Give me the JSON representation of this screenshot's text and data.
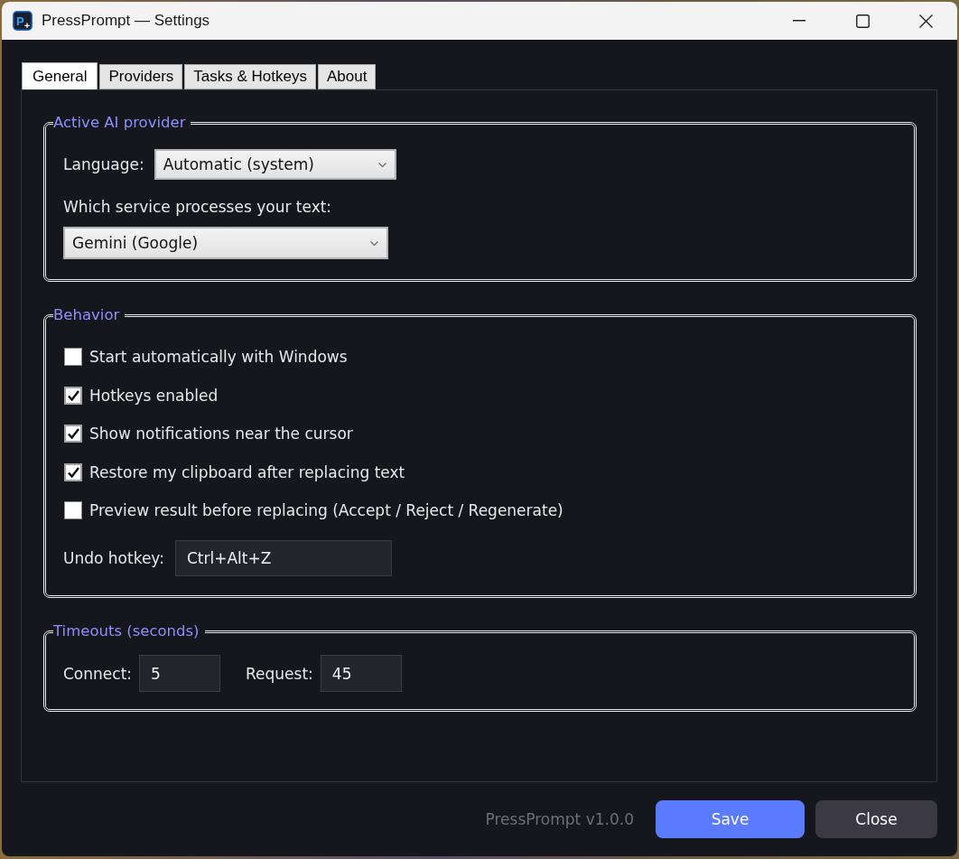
{
  "window": {
    "title": "PressPrompt — Settings",
    "logo_text": "P"
  },
  "tabs": [
    {
      "label": "General",
      "selected": true
    },
    {
      "label": "Providers",
      "selected": false
    },
    {
      "label": "Tasks & Hotkeys",
      "selected": false
    },
    {
      "label": "About",
      "selected": false
    }
  ],
  "provider_group": {
    "title": "Active AI provider",
    "language": {
      "label": "Language:",
      "value": "Automatic (system)"
    },
    "service": {
      "label": "Which service processes your text:",
      "value": "Gemini (Google)"
    }
  },
  "behavior_group": {
    "title": "Behavior",
    "options": [
      {
        "label": "Start automatically with Windows",
        "checked": false
      },
      {
        "label": "Hotkeys enabled",
        "checked": true
      },
      {
        "label": "Show notifications near the cursor",
        "checked": true
      },
      {
        "label": "Restore my clipboard after replacing text",
        "checked": true
      },
      {
        "label": "Preview result before replacing (Accept / Reject / Regenerate)",
        "checked": false
      }
    ],
    "undo_hotkey": {
      "label": "Undo hotkey:",
      "value": "Ctrl+Alt+Z"
    }
  },
  "timeouts_group": {
    "title": "Timeouts (seconds)",
    "fields": [
      {
        "label": "Connect:",
        "value": "5"
      },
      {
        "label": "Request:",
        "value": "45"
      }
    ]
  },
  "footer": {
    "version": "PressPrompt v1.0.0",
    "buttons": [
      {
        "label": "Save",
        "kind": "primary"
      },
      {
        "label": "Close",
        "kind": "secondary"
      }
    ]
  }
}
